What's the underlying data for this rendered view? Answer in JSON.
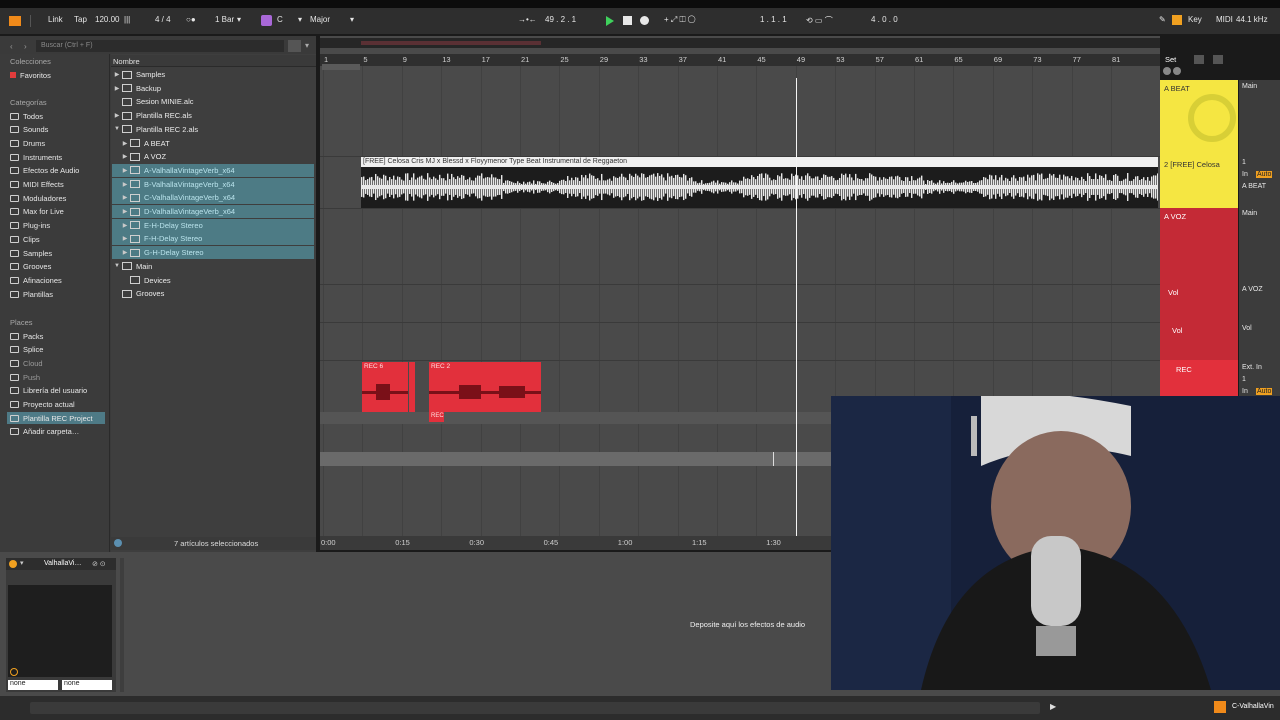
{
  "topbar": {
    "link": "Link",
    "tap": "Tap",
    "tempo": "120.00",
    "signature": "4 / 4",
    "quantize": "1 Bar",
    "key": "C",
    "scale": "Major",
    "position": "49 .  2 .  1",
    "loop_start": "1 .  1 .  1",
    "loop_length": "4 .  0 .  0",
    "key_label": "Key",
    "midi_label": "MIDI",
    "sample_rate": "44.1 kHz"
  },
  "browser": {
    "search_placeholder": "Buscar (Ctrl + F)",
    "name_header": "Nombre",
    "collections_title": "Colecciones",
    "favorites": "Favoritos",
    "categories_title": "Categorías",
    "categories": [
      "Todos",
      "Sounds",
      "Drums",
      "Instruments",
      "Efectos de Audio",
      "MIDI Effects",
      "Moduladores",
      "Max for Live",
      "Plug-ins",
      "Clips",
      "Samples",
      "Grooves",
      "Afinaciones",
      "Plantillas"
    ],
    "places_title": "Places",
    "places": [
      "Packs",
      "Splice",
      "Cloud",
      "Push",
      "Librería del usuario",
      "Proyecto actual",
      "Plantilla REC Project",
      "Añadir carpeta…"
    ],
    "files": [
      "Samples",
      "Backup",
      "Sesion MINIE.alc",
      "Plantilla REC.als",
      "Plantilla REC 2.als",
      "A BEAT",
      "A VOZ",
      "A-ValhallaVintageVerb_x64",
      "B-ValhallaVintageVerb_x64",
      "C-ValhallaVintageVerb_x64",
      "D-ValhallaVintageVerb_x64",
      "E-H-Delay Stereo",
      "F-H-Delay Stereo",
      "G-H-Delay Stereo",
      "Main",
      "Devices",
      "Grooves"
    ],
    "selection_status": "7 artículos seleccionados"
  },
  "arrangement": {
    "bar_numbers": [
      "1",
      "5",
      "9",
      "13",
      "17",
      "21",
      "25",
      "29",
      "33",
      "37",
      "41",
      "45",
      "49",
      "53",
      "57",
      "61",
      "65",
      "69",
      "73",
      "77",
      "81"
    ],
    "beat_clip_title": "[FREE] Celosa Cris MJ x Blessd x Floyymenor Type Beat  Instrumental de Reggaeton",
    "rec_clip_1": "REC 6",
    "rec_clip_2": "REC 2",
    "rec_clip_3": "REC",
    "time_labels": [
      "0:00",
      "0:15",
      "0:30",
      "0:45",
      "1:00",
      "1:15",
      "1:30"
    ],
    "set_label": "Set"
  },
  "mixer": {
    "tracks": [
      {
        "name": "A BEAT",
        "color": "#f5e642",
        "output": "Main"
      },
      {
        "name": "2 [FREE] Celosa",
        "color": "#f5e642",
        "input": "1",
        "input_mode": "In",
        "monitor": "Auto",
        "output": "A BEAT"
      },
      {
        "name": "A VOZ",
        "color": "#c42a36",
        "output": "Main"
      },
      {
        "name": "Vol",
        "color": "#c42a36",
        "output": "A VOZ"
      },
      {
        "name": "Vol",
        "color": "#c42a36",
        "output": "Vol"
      },
      {
        "name": "REC",
        "color": "#e2303c",
        "input": "Ext. In",
        "channel": "1",
        "input_mode": "In",
        "monitor": "Auto"
      }
    ]
  },
  "detail": {
    "device_name": "ValhallaVi…",
    "drop_hint": "Deposite aquí los efectos de audio",
    "select_a": "none",
    "select_b": "none"
  },
  "statusbar": {
    "track_label": "C-ValhallaVin"
  },
  "colors": {
    "accent": "#f5e642",
    "rec": "#e2303c",
    "selection": "#4d7b85"
  }
}
